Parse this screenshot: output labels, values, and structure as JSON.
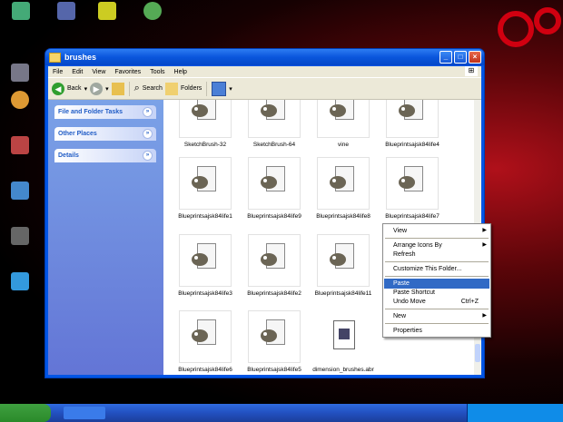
{
  "window": {
    "title": "brushes",
    "controls": {
      "minimize": "_",
      "maximize": "□",
      "close": "×"
    }
  },
  "menubar": [
    "File",
    "Edit",
    "View",
    "Favorites",
    "Tools",
    "Help"
  ],
  "toolbar": {
    "back": "Back",
    "search": "Search",
    "folders": "Folders"
  },
  "taskpane": {
    "panels": [
      "File and Folder Tasks",
      "Other Places",
      "Details"
    ]
  },
  "files": [
    "SketchBrush-32",
    "SketchBrush-64",
    "vine",
    "Blueprintsajsk84life4",
    "Blueprintsajsk84life1",
    "Blueprintsajsk84life9",
    "Blueprintsajsk84life8",
    "Blueprintsajsk84life7",
    "Blueprintsajsk84life3",
    "Blueprintsajsk84life2",
    "Blueprintsajsk84life11",
    "Blueprintsajsk84life6",
    "Blueprintsajsk84life5",
    "dimension_brushes.abr"
  ],
  "context_menu": {
    "view": "View",
    "arrange": "Arrange Icons By",
    "refresh": "Refresh",
    "customize": "Customize This Folder...",
    "paste": "Paste",
    "paste_shortcut": "Paste Shortcut",
    "undo": "Undo Move",
    "undo_shortcut": "Ctrl+Z",
    "new": "New",
    "properties": "Properties"
  },
  "colors": {
    "titlebar": "#0a56dc",
    "taskpane": "#6f8ee0",
    "highlight": "#316ac5"
  }
}
